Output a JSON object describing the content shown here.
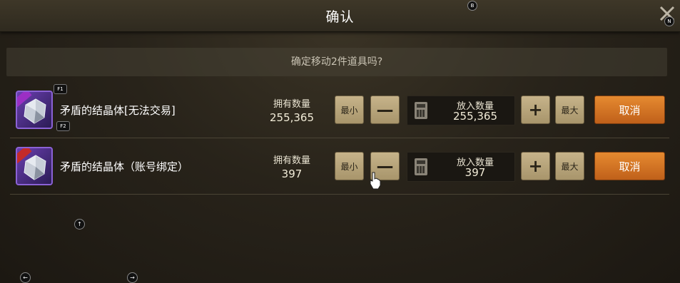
{
  "dialog": {
    "title": "确认",
    "prompt": "确定移动2件道具吗?",
    "hotkeys": {
      "top": "B",
      "close": "N"
    }
  },
  "labels": {
    "owned": "拥有数量",
    "put": "放入数量",
    "min": "最小",
    "minus": "—",
    "plus": "+",
    "max": "最大",
    "cancel": "取消"
  },
  "items": [
    {
      "name": "矛盾的结晶体[无法交易]",
      "owned": "255,365",
      "put": "255,365",
      "hotkeys": [
        "F1",
        "F2"
      ],
      "icon": "gem-icon"
    },
    {
      "name": "矛盾的结晶体（账号绑定）",
      "owned": "397",
      "put": "397",
      "hotkeys": [],
      "icon": "gem-icon"
    }
  ],
  "controller_hints": {
    "up": "↑",
    "left": "←",
    "right": "→"
  },
  "colors": {
    "accent": "#d8721f",
    "button": "#b8a47a",
    "background": "#28231a"
  }
}
